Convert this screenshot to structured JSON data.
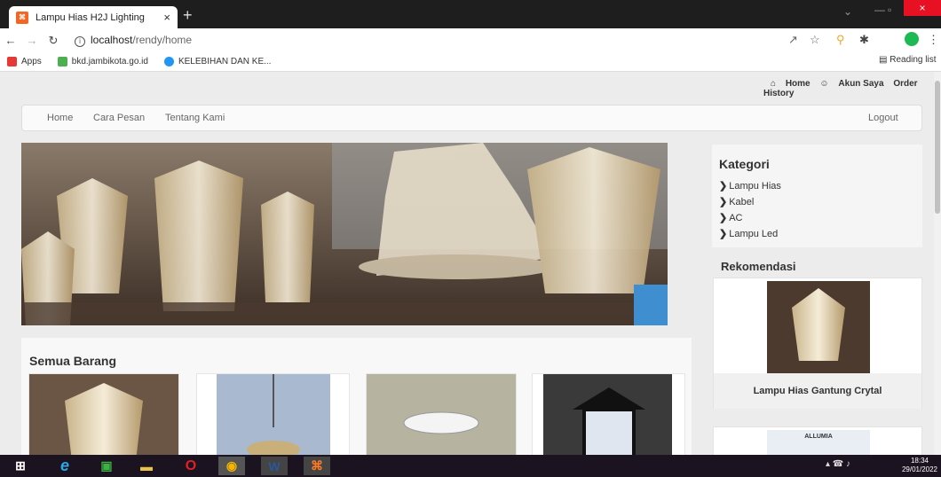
{
  "browser": {
    "tab_title": "Lampu Hias H2J Lighting",
    "tab_close": "×",
    "new_tab": "+",
    "url_host": "localhost",
    "url_path": "/rendy/home",
    "bookmarks": [
      "Apps",
      "bkd.jambikota.go.id",
      "KELEBIHAN DAN KE..."
    ],
    "reading_list": "Reading list",
    "window_minimize": "—",
    "window_maximize": "▫",
    "window_close": "×"
  },
  "site": {
    "top_links": {
      "home": "Home",
      "account": "Akun Saya",
      "orders": "Order History"
    },
    "nav": {
      "home": "Home",
      "cara_pesan": "Cara Pesan",
      "tentang": "Tentang Kami",
      "logout": "Logout"
    },
    "section_title": "Semua Barang",
    "kategori": {
      "title": "Kategori",
      "items": [
        "Lampu Hias",
        "Kabel",
        "AC",
        "Lampu Led"
      ]
    },
    "rekomendasi": {
      "title": "Rekomendasi",
      "items": [
        {
          "name": "Lampu Hias Gantung Crytal"
        },
        {
          "brand": "ALLUMIA"
        }
      ]
    }
  },
  "taskbar": {
    "time": "18:34",
    "date": "29/01/2022"
  }
}
